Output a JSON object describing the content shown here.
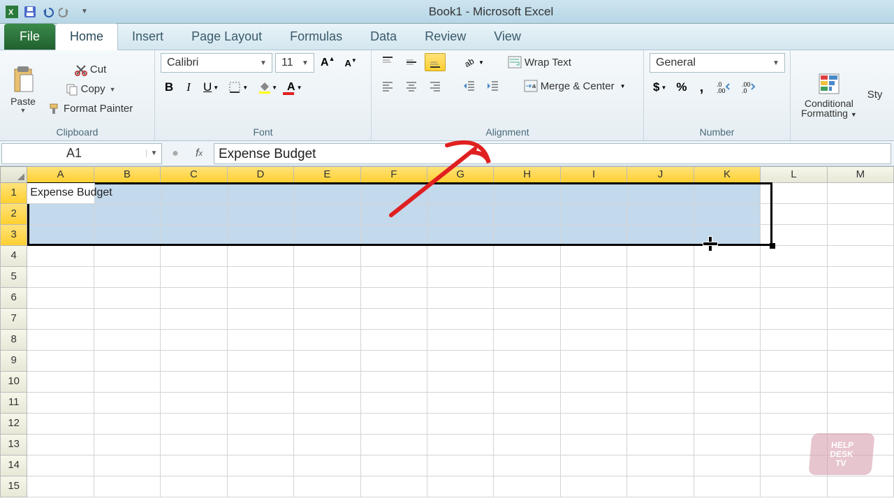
{
  "title": "Book1  -  Microsoft Excel",
  "tabs": {
    "file": "File",
    "items": [
      "Home",
      "Insert",
      "Page Layout",
      "Formulas",
      "Data",
      "Review",
      "View"
    ],
    "active": 0
  },
  "ribbon": {
    "clipboard": {
      "paste": "Paste",
      "cut": "Cut",
      "copy": "Copy",
      "format_painter": "Format Painter",
      "label": "Clipboard"
    },
    "font": {
      "name": "Calibri",
      "size": "11",
      "label": "Font"
    },
    "alignment": {
      "wrap": "Wrap Text",
      "merge": "Merge & Center",
      "label": "Alignment"
    },
    "number": {
      "format": "General",
      "label": "Number"
    },
    "styles": {
      "conditional": "Conditional",
      "formatting": "Formatting",
      "label": "Sty"
    }
  },
  "namebox": "A1",
  "formula": "Expense Budget",
  "columns": [
    "A",
    "B",
    "C",
    "D",
    "E",
    "F",
    "G",
    "H",
    "I",
    "J",
    "K",
    "L",
    "M"
  ],
  "rows_count": 15,
  "selected_cols": 11,
  "selected_rows": 3,
  "cells": {
    "A1": "Expense Budget"
  },
  "watermark": [
    "HELP",
    "DESK",
    "TV"
  ]
}
